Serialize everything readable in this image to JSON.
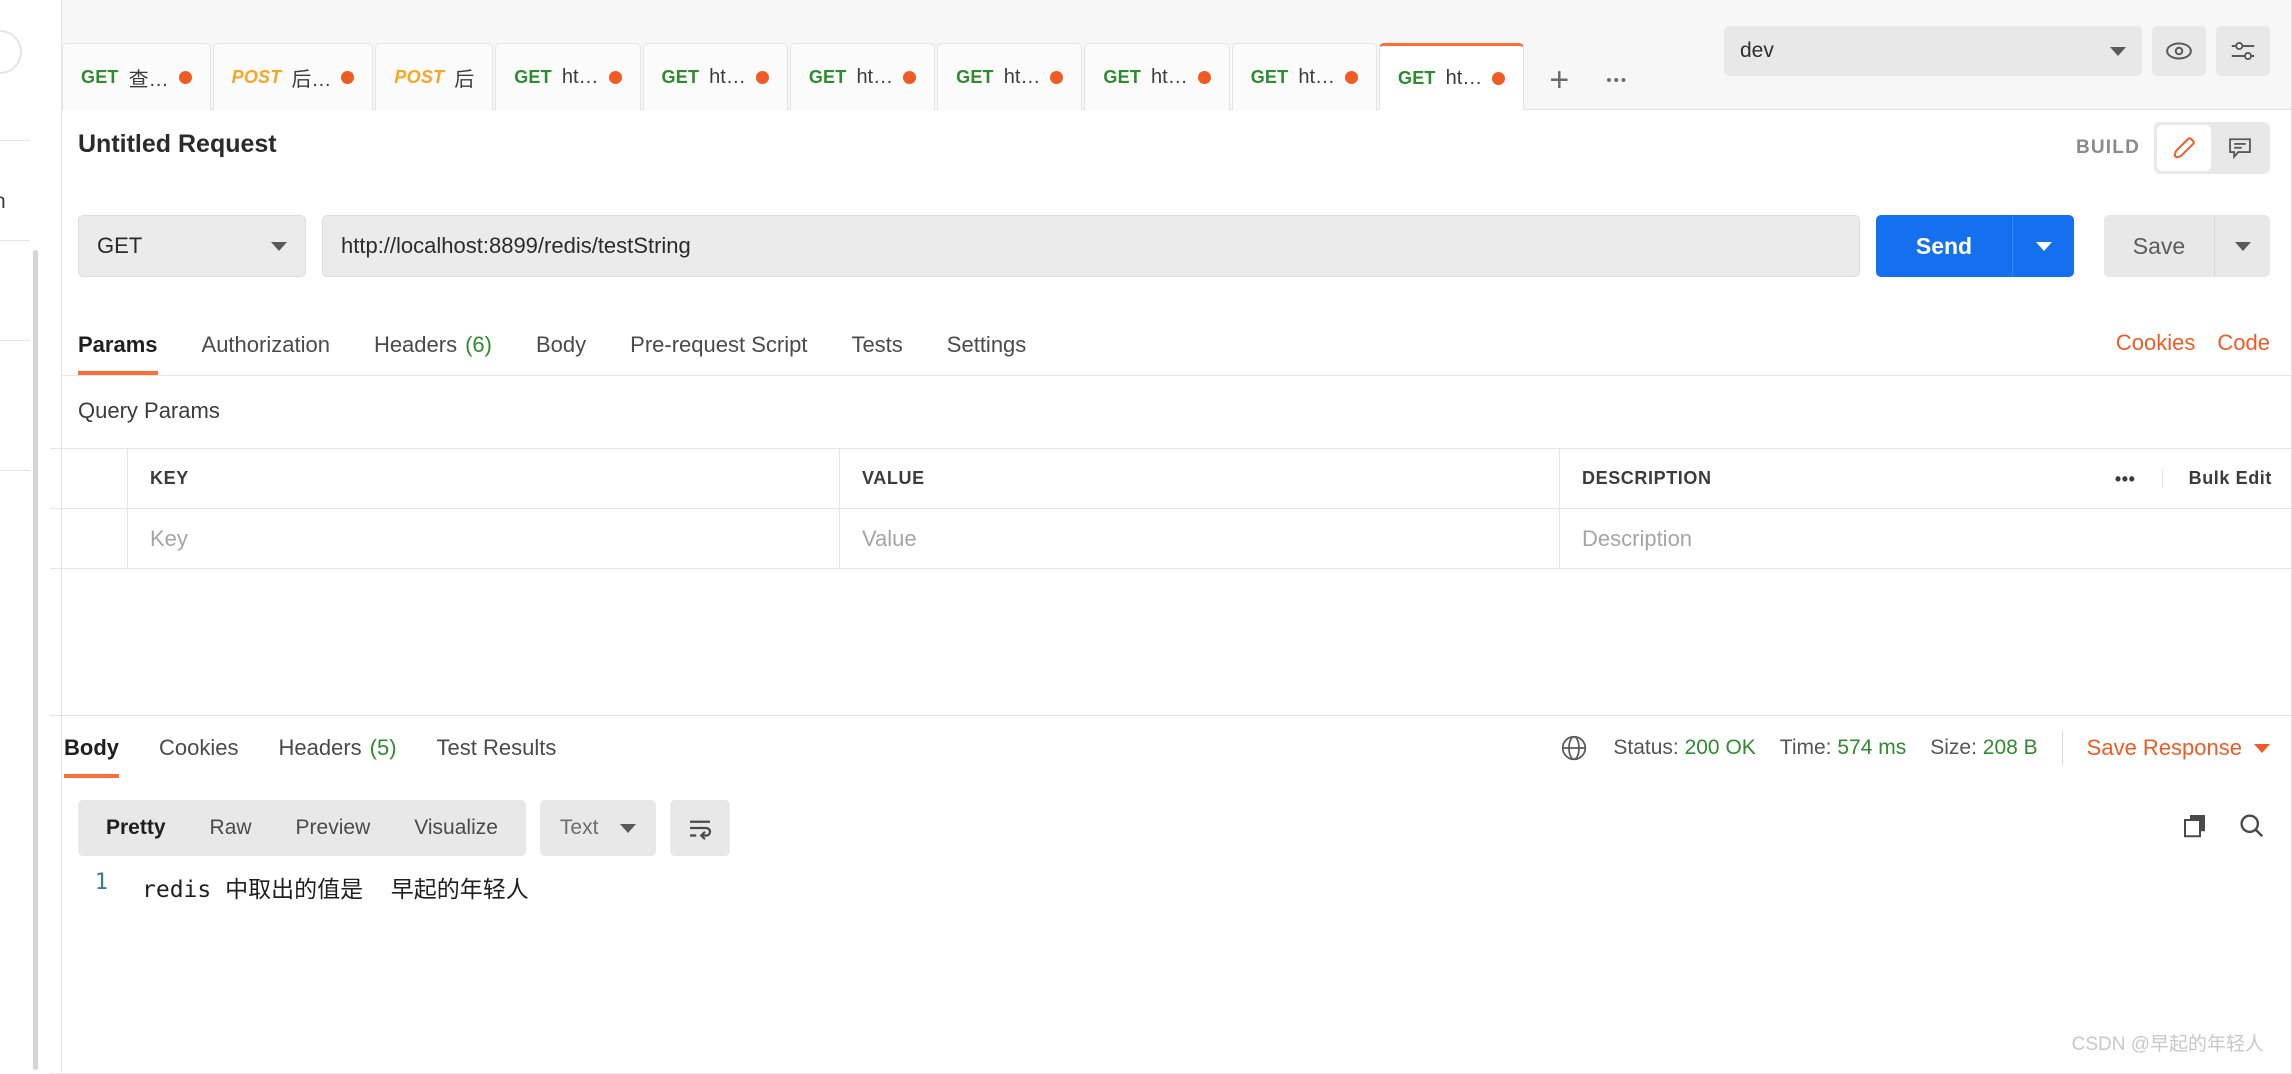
{
  "tabstrip": {
    "tabs": [
      {
        "method": "GET",
        "label": "查…",
        "dirty": true,
        "active": false
      },
      {
        "method": "POST",
        "label": "后…",
        "dirty": true,
        "active": false
      },
      {
        "method": "POST",
        "label": "后",
        "dirty": false,
        "active": false
      },
      {
        "method": "GET",
        "label": "ht…",
        "dirty": true,
        "active": false
      },
      {
        "method": "GET",
        "label": "ht…",
        "dirty": true,
        "active": false
      },
      {
        "method": "GET",
        "label": "ht…",
        "dirty": true,
        "active": false
      },
      {
        "method": "GET",
        "label": "ht…",
        "dirty": true,
        "active": false
      },
      {
        "method": "GET",
        "label": "ht…",
        "dirty": true,
        "active": false
      },
      {
        "method": "GET",
        "label": "ht…",
        "dirty": true,
        "active": false
      },
      {
        "method": "GET",
        "label": "ht…",
        "dirty": true,
        "active": true
      }
    ],
    "add_label": "+",
    "more_label": "•••",
    "environment": "dev",
    "eye_icon": "eye-icon",
    "settings_icon": "sliders-icon"
  },
  "request_header": {
    "title": "Untitled Request",
    "build_label": "BUILD",
    "edit_icon": "pencil-icon",
    "comment_icon": "comment-icon"
  },
  "url_row": {
    "method": "GET",
    "url": "http://localhost:8899/redis/testString",
    "send_label": "Send",
    "save_label": "Save"
  },
  "request_tabs": [
    {
      "label": "Params",
      "count": "",
      "active": true
    },
    {
      "label": "Authorization",
      "count": "",
      "active": false
    },
    {
      "label": "Headers",
      "count": "(6)",
      "active": false
    },
    {
      "label": "Body",
      "count": "",
      "active": false
    },
    {
      "label": "Pre-request Script",
      "count": "",
      "active": false
    },
    {
      "label": "Tests",
      "count": "",
      "active": false
    },
    {
      "label": "Settings",
      "count": "",
      "active": false
    }
  ],
  "right_links": {
    "cookies": "Cookies",
    "code": "Code"
  },
  "query_params": {
    "title": "Query Params",
    "headers": {
      "key": "KEY",
      "value": "VALUE",
      "description": "DESCRIPTION"
    },
    "placeholders": {
      "key": "Key",
      "value": "Value",
      "description": "Description"
    },
    "dots_label": "•••",
    "bulk_edit": "Bulk Edit"
  },
  "response_tabs": [
    {
      "label": "Body",
      "count": "",
      "active": true
    },
    {
      "label": "Cookies",
      "count": "",
      "active": false
    },
    {
      "label": "Headers",
      "count": "(5)",
      "active": false
    },
    {
      "label": "Test Results",
      "count": "",
      "active": false
    }
  ],
  "response_meta": {
    "globe_icon": "globe-icon",
    "status_label": "Status:",
    "status_value": "200 OK",
    "time_label": "Time:",
    "time_value": "574 ms",
    "size_label": "Size:",
    "size_value": "208 B",
    "save_response": "Save Response"
  },
  "body_toolbar": {
    "views": [
      {
        "label": "Pretty",
        "active": true
      },
      {
        "label": "Raw",
        "active": false
      },
      {
        "label": "Preview",
        "active": false
      },
      {
        "label": "Visualize",
        "active": false
      }
    ],
    "format": "Text",
    "wrap_icon": "word-wrap-icon",
    "copy_icon": "copy-icon",
    "search_icon": "search-icon"
  },
  "body_content": {
    "line_number": "1",
    "line_text": "redis 中取出的值是  早起的年轻人"
  },
  "left_sliver": {
    "text": "h"
  },
  "watermark": "CSDN @早起的年轻人",
  "colors": {
    "accent": "#ff6c37",
    "link": "#ef5b25",
    "send": "#1570ef",
    "get": "#2e8b2e",
    "post": "#f5a623",
    "success": "#2e8b2e"
  }
}
